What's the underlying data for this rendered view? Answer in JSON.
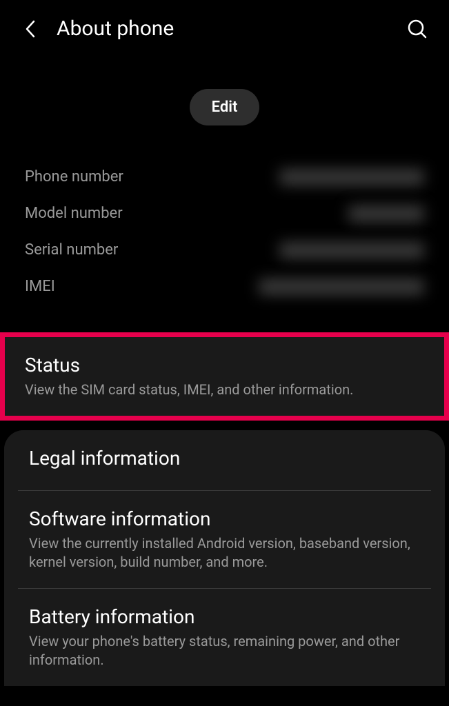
{
  "header": {
    "title": "About phone"
  },
  "editButton": {
    "label": "Edit"
  },
  "infoRows": [
    {
      "label": "Phone number"
    },
    {
      "label": "Model number"
    },
    {
      "label": "Serial number"
    },
    {
      "label": "IMEI"
    }
  ],
  "menu": {
    "status": {
      "title": "Status",
      "description": "View the SIM card status, IMEI, and other information."
    },
    "legal": {
      "title": "Legal information"
    },
    "software": {
      "title": "Software information",
      "description": "View the currently installed Android version, baseband version, kernel version, build number, and more."
    },
    "battery": {
      "title": "Battery information",
      "description": "View your phone's battery status, remaining power, and other information."
    }
  }
}
